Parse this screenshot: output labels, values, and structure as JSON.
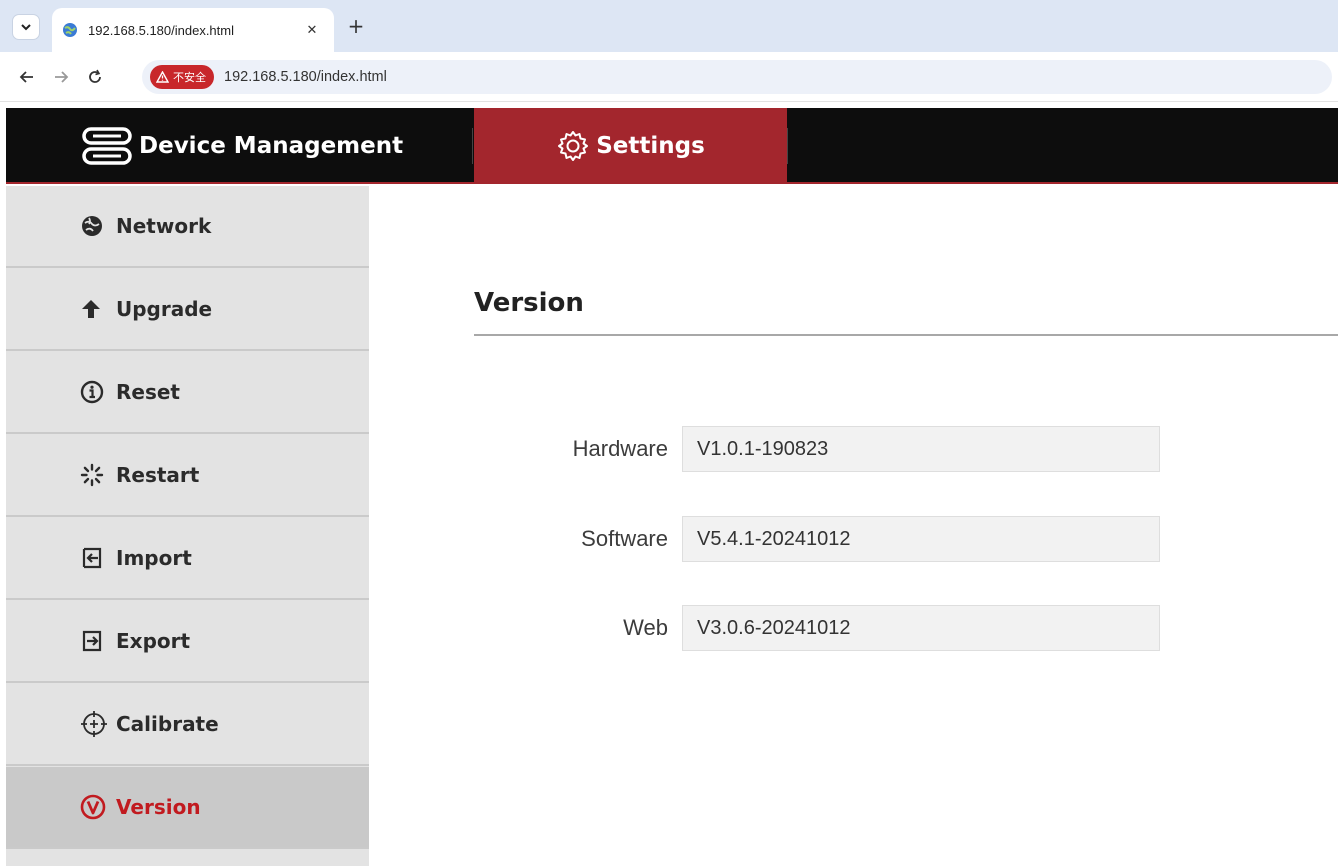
{
  "browser": {
    "tab_title": "192.168.5.180/index.html",
    "tab_close": "✕",
    "new_tab": "+",
    "insecure_label": "不安全",
    "url": "192.168.5.180/index.html"
  },
  "header": {
    "brand": "Device Management",
    "active_nav": "Settings"
  },
  "sidebar": {
    "items": [
      {
        "label": "Network",
        "icon": "globe-icon"
      },
      {
        "label": "Upgrade",
        "icon": "arrow-up-icon"
      },
      {
        "label": "Reset",
        "icon": "info-icon"
      },
      {
        "label": "Restart",
        "icon": "spinner-icon"
      },
      {
        "label": "Import",
        "icon": "import-icon"
      },
      {
        "label": "Export",
        "icon": "export-icon"
      },
      {
        "label": "Calibrate",
        "icon": "crosshair-icon"
      },
      {
        "label": "Version",
        "icon": "version-icon",
        "active": true
      }
    ]
  },
  "main": {
    "title": "Version",
    "fields": [
      {
        "label": "Hardware",
        "value": "V1.0.1-190823"
      },
      {
        "label": "Software",
        "value": "V5.4.1-20241012"
      },
      {
        "label": "Web",
        "value": "V3.0.6-20241012"
      }
    ]
  },
  "colors": {
    "accent": "#a3262d",
    "active_text": "#c11a1f",
    "header_bg": "#0d0d0d",
    "sidebar_bg": "#e3e3e3"
  }
}
